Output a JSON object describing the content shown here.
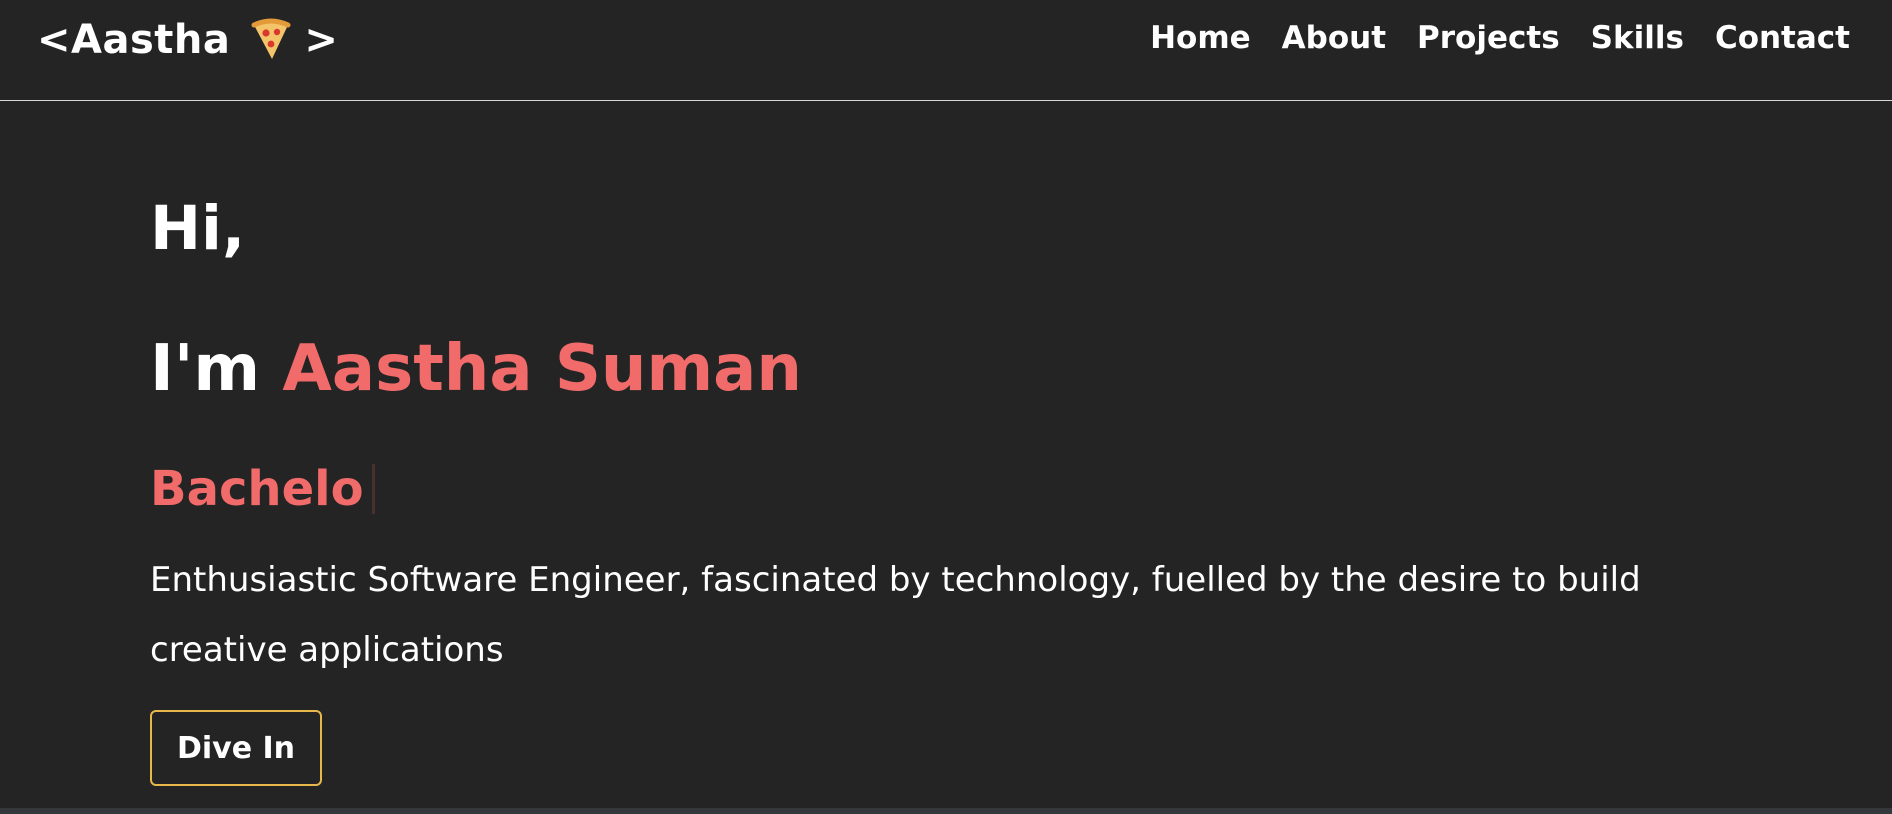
{
  "header": {
    "logo_prefix": "<Aastha",
    "logo_icon": "pizza-icon",
    "logo_suffix": ">",
    "nav": [
      {
        "label": "Home"
      },
      {
        "label": "About"
      },
      {
        "label": "Projects"
      },
      {
        "label": "Skills"
      },
      {
        "label": "Contact"
      }
    ]
  },
  "hero": {
    "greeting": "Hi,",
    "intro_prefix": "I'm ",
    "name": "Aastha Suman",
    "typed_text": "Bachelo",
    "tagline": "Enthusiastic Software Engineer, fascinated by technology, fuelled by the desire to build creative applications",
    "cta_label": "Dive In"
  },
  "colors": {
    "background": "#242424",
    "accent": "#f26b6b",
    "button_border": "#e7b84a",
    "text": "#ffffff"
  }
}
